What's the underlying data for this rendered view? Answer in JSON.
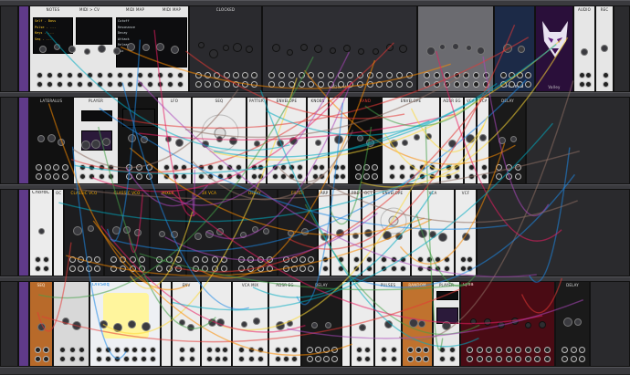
{
  "colors": {
    "rack_bg": "#1b1b1d",
    "rail": "#3a3a3e",
    "cable_palette": [
      "#e53935",
      "#fb8c00",
      "#43a047",
      "#1e88e5",
      "#ab47bc",
      "#00acc1",
      "#fdd835",
      "#e91e63",
      "#8d6e63"
    ]
  },
  "top_row": {
    "midi_map_panel": {
      "headers": [
        "NOTES",
        "MIDI > CV",
        "MIDI MAP",
        "MIDI MAP"
      ],
      "lines_left": [
        "Self - Bass",
        "Pulse - ...",
        "Keys - ...",
        "Seq - ..."
      ],
      "lines_right": [
        "Cutoff",
        "Resonance",
        "Decay",
        "Attack",
        "Release",
        "Mix"
      ]
    },
    "clocked_label": "CLOCKED",
    "plateau_label": "Plateau",
    "valley_label": "Valley",
    "audio_label": "AUDIO",
    "rec_label": "REC",
    "mixer_label": "AUDIO MIX"
  },
  "row2": {
    "modules": [
      "LATERALUS",
      "PLAYER",
      "LFO",
      "SEQ",
      "PATTERN",
      "ENVELOPE",
      "KNOBS",
      "RAND",
      "ENVELOPE",
      "ADSR EG",
      "VCA",
      "VCA",
      "DELAY"
    ]
  },
  "row3": {
    "modules": [
      "ChordCV",
      "OCT",
      "CLASSIC VCO",
      "CLASSIC VCO",
      "MIXER",
      "3X VCA",
      "DELAY",
      "FILTER",
      "ARP",
      "PRESSED",
      "OCT",
      "ENVELOPE",
      "VCA",
      "VCF"
    ]
  },
  "row4": {
    "modules": [
      "SEQ",
      "DivSeq",
      "ENV",
      "VCA MIX",
      "ADSR EG",
      "DELAY",
      "PULSES",
      "RANDOM",
      "PLAYER",
      "Lysa",
      "DELAY"
    ]
  }
}
